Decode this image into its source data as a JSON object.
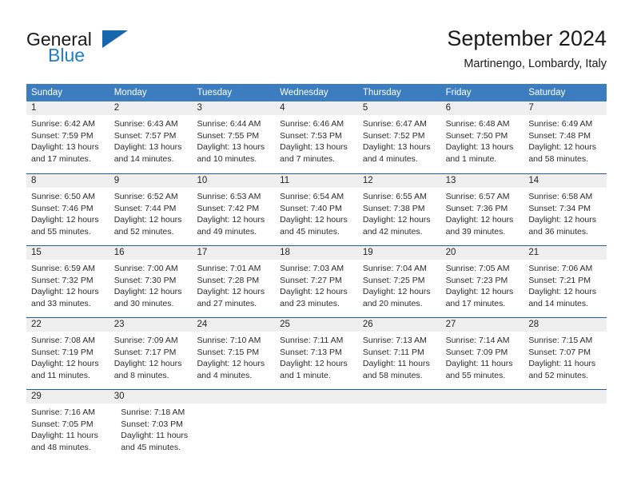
{
  "brand": {
    "name_part1": "General",
    "name_part2": "Blue",
    "logo_icon": "blue-triangle-icon"
  },
  "header": {
    "title": "September 2024",
    "location": "Martinengo, Lombardy, Italy"
  },
  "colors": {
    "header_band": "#3c7dc0",
    "row_divider": "#1f5fa0",
    "daynum_strip": "#efefef",
    "brand_blue": "#1f7fc4",
    "text": "#2b2b2b"
  },
  "weekdays": [
    "Sunday",
    "Monday",
    "Tuesday",
    "Wednesday",
    "Thursday",
    "Friday",
    "Saturday"
  ],
  "labels": {
    "sunrise_prefix": "Sunrise:",
    "sunset_prefix": "Sunset:",
    "daylight_prefix": "Daylight:"
  },
  "weeks": [
    {
      "days": [
        {
          "num": "1",
          "sunrise": "Sunrise: 6:42 AM",
          "sunset": "Sunset: 7:59 PM",
          "daylight_line1": "Daylight: 13 hours",
          "daylight_line2": "and 17 minutes."
        },
        {
          "num": "2",
          "sunrise": "Sunrise: 6:43 AM",
          "sunset": "Sunset: 7:57 PM",
          "daylight_line1": "Daylight: 13 hours",
          "daylight_line2": "and 14 minutes."
        },
        {
          "num": "3",
          "sunrise": "Sunrise: 6:44 AM",
          "sunset": "Sunset: 7:55 PM",
          "daylight_line1": "Daylight: 13 hours",
          "daylight_line2": "and 10 minutes."
        },
        {
          "num": "4",
          "sunrise": "Sunrise: 6:46 AM",
          "sunset": "Sunset: 7:53 PM",
          "daylight_line1": "Daylight: 13 hours",
          "daylight_line2": "and 7 minutes."
        },
        {
          "num": "5",
          "sunrise": "Sunrise: 6:47 AM",
          "sunset": "Sunset: 7:52 PM",
          "daylight_line1": "Daylight: 13 hours",
          "daylight_line2": "and 4 minutes."
        },
        {
          "num": "6",
          "sunrise": "Sunrise: 6:48 AM",
          "sunset": "Sunset: 7:50 PM",
          "daylight_line1": "Daylight: 13 hours",
          "daylight_line2": "and 1 minute."
        },
        {
          "num": "7",
          "sunrise": "Sunrise: 6:49 AM",
          "sunset": "Sunset: 7:48 PM",
          "daylight_line1": "Daylight: 12 hours",
          "daylight_line2": "and 58 minutes."
        }
      ]
    },
    {
      "days": [
        {
          "num": "8",
          "sunrise": "Sunrise: 6:50 AM",
          "sunset": "Sunset: 7:46 PM",
          "daylight_line1": "Daylight: 12 hours",
          "daylight_line2": "and 55 minutes."
        },
        {
          "num": "9",
          "sunrise": "Sunrise: 6:52 AM",
          "sunset": "Sunset: 7:44 PM",
          "daylight_line1": "Daylight: 12 hours",
          "daylight_line2": "and 52 minutes."
        },
        {
          "num": "10",
          "sunrise": "Sunrise: 6:53 AM",
          "sunset": "Sunset: 7:42 PM",
          "daylight_line1": "Daylight: 12 hours",
          "daylight_line2": "and 49 minutes."
        },
        {
          "num": "11",
          "sunrise": "Sunrise: 6:54 AM",
          "sunset": "Sunset: 7:40 PM",
          "daylight_line1": "Daylight: 12 hours",
          "daylight_line2": "and 45 minutes."
        },
        {
          "num": "12",
          "sunrise": "Sunrise: 6:55 AM",
          "sunset": "Sunset: 7:38 PM",
          "daylight_line1": "Daylight: 12 hours",
          "daylight_line2": "and 42 minutes."
        },
        {
          "num": "13",
          "sunrise": "Sunrise: 6:57 AM",
          "sunset": "Sunset: 7:36 PM",
          "daylight_line1": "Daylight: 12 hours",
          "daylight_line2": "and 39 minutes."
        },
        {
          "num": "14",
          "sunrise": "Sunrise: 6:58 AM",
          "sunset": "Sunset: 7:34 PM",
          "daylight_line1": "Daylight: 12 hours",
          "daylight_line2": "and 36 minutes."
        }
      ]
    },
    {
      "days": [
        {
          "num": "15",
          "sunrise": "Sunrise: 6:59 AM",
          "sunset": "Sunset: 7:32 PM",
          "daylight_line1": "Daylight: 12 hours",
          "daylight_line2": "and 33 minutes."
        },
        {
          "num": "16",
          "sunrise": "Sunrise: 7:00 AM",
          "sunset": "Sunset: 7:30 PM",
          "daylight_line1": "Daylight: 12 hours",
          "daylight_line2": "and 30 minutes."
        },
        {
          "num": "17",
          "sunrise": "Sunrise: 7:01 AM",
          "sunset": "Sunset: 7:28 PM",
          "daylight_line1": "Daylight: 12 hours",
          "daylight_line2": "and 27 minutes."
        },
        {
          "num": "18",
          "sunrise": "Sunrise: 7:03 AM",
          "sunset": "Sunset: 7:27 PM",
          "daylight_line1": "Daylight: 12 hours",
          "daylight_line2": "and 23 minutes."
        },
        {
          "num": "19",
          "sunrise": "Sunrise: 7:04 AM",
          "sunset": "Sunset: 7:25 PM",
          "daylight_line1": "Daylight: 12 hours",
          "daylight_line2": "and 20 minutes."
        },
        {
          "num": "20",
          "sunrise": "Sunrise: 7:05 AM",
          "sunset": "Sunset: 7:23 PM",
          "daylight_line1": "Daylight: 12 hours",
          "daylight_line2": "and 17 minutes."
        },
        {
          "num": "21",
          "sunrise": "Sunrise: 7:06 AM",
          "sunset": "Sunset: 7:21 PM",
          "daylight_line1": "Daylight: 12 hours",
          "daylight_line2": "and 14 minutes."
        }
      ]
    },
    {
      "days": [
        {
          "num": "22",
          "sunrise": "Sunrise: 7:08 AM",
          "sunset": "Sunset: 7:19 PM",
          "daylight_line1": "Daylight: 12 hours",
          "daylight_line2": "and 11 minutes."
        },
        {
          "num": "23",
          "sunrise": "Sunrise: 7:09 AM",
          "sunset": "Sunset: 7:17 PM",
          "daylight_line1": "Daylight: 12 hours",
          "daylight_line2": "and 8 minutes."
        },
        {
          "num": "24",
          "sunrise": "Sunrise: 7:10 AM",
          "sunset": "Sunset: 7:15 PM",
          "daylight_line1": "Daylight: 12 hours",
          "daylight_line2": "and 4 minutes."
        },
        {
          "num": "25",
          "sunrise": "Sunrise: 7:11 AM",
          "sunset": "Sunset: 7:13 PM",
          "daylight_line1": "Daylight: 12 hours",
          "daylight_line2": "and 1 minute."
        },
        {
          "num": "26",
          "sunrise": "Sunrise: 7:13 AM",
          "sunset": "Sunset: 7:11 PM",
          "daylight_line1": "Daylight: 11 hours",
          "daylight_line2": "and 58 minutes."
        },
        {
          "num": "27",
          "sunrise": "Sunrise: 7:14 AM",
          "sunset": "Sunset: 7:09 PM",
          "daylight_line1": "Daylight: 11 hours",
          "daylight_line2": "and 55 minutes."
        },
        {
          "num": "28",
          "sunrise": "Sunrise: 7:15 AM",
          "sunset": "Sunset: 7:07 PM",
          "daylight_line1": "Daylight: 11 hours",
          "daylight_line2": "and 52 minutes."
        }
      ]
    },
    {
      "days": [
        {
          "num": "29",
          "sunrise": "Sunrise: 7:16 AM",
          "sunset": "Sunset: 7:05 PM",
          "daylight_line1": "Daylight: 11 hours",
          "daylight_line2": "and 48 minutes."
        },
        {
          "num": "30",
          "sunrise": "Sunrise: 7:18 AM",
          "sunset": "Sunset: 7:03 PM",
          "daylight_line1": "Daylight: 11 hours",
          "daylight_line2": "and 45 minutes."
        },
        {
          "num": "",
          "sunrise": "",
          "sunset": "",
          "daylight_line1": "",
          "daylight_line2": ""
        },
        {
          "num": "",
          "sunrise": "",
          "sunset": "",
          "daylight_line1": "",
          "daylight_line2": ""
        },
        {
          "num": "",
          "sunrise": "",
          "sunset": "",
          "daylight_line1": "",
          "daylight_line2": ""
        },
        {
          "num": "",
          "sunrise": "",
          "sunset": "",
          "daylight_line1": "",
          "daylight_line2": ""
        },
        {
          "num": "",
          "sunrise": "",
          "sunset": "",
          "daylight_line1": "",
          "daylight_line2": ""
        }
      ]
    }
  ]
}
